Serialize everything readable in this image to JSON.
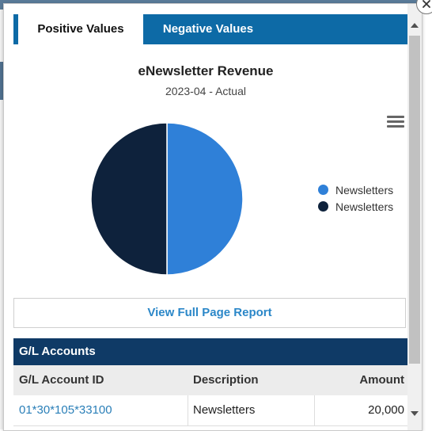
{
  "tabs": [
    {
      "label": "Positive Values",
      "active": true
    },
    {
      "label": "Negative Values",
      "active": false
    }
  ],
  "chart_data": {
    "type": "pie",
    "title": "eNewsletter Revenue",
    "subtitle": "2023-04 - Actual",
    "slices": [
      {
        "label": "Newsletters",
        "value": 50,
        "color": "#2f80d8"
      },
      {
        "label": "Newsletters",
        "value": 50,
        "color": "#0e223c"
      }
    ],
    "legend_position": "right"
  },
  "menu_icon": "hamburger-menu-icon",
  "view_report_label": "View Full Page Report",
  "gl": {
    "title": "G/L Accounts",
    "columns": [
      "G/L Account ID",
      "Description",
      "Amount"
    ],
    "rows": [
      {
        "id": "01*30*105*33100",
        "description": "Newsletters",
        "amount": "20,000"
      }
    ]
  },
  "colors": {
    "tab_bar": "#0d6aa6",
    "gl_header": "#0f3a66",
    "link": "#2b87c8"
  }
}
